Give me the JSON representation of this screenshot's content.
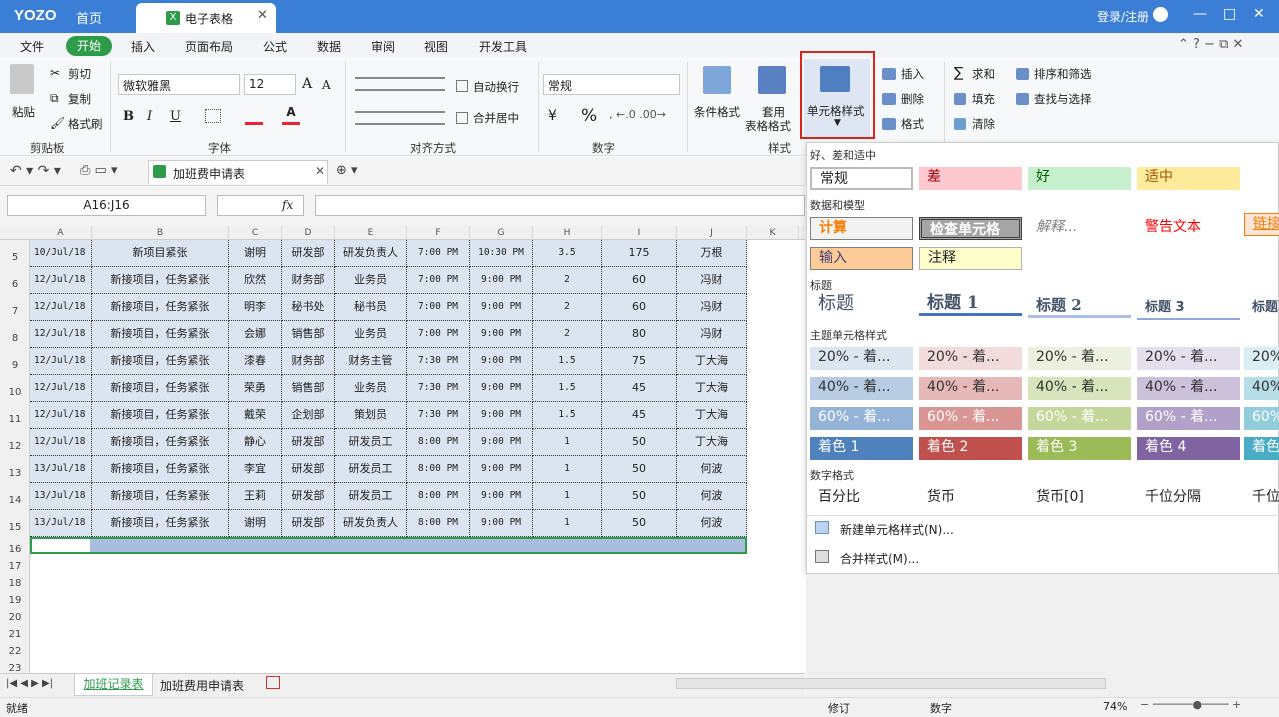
{
  "titlebar": {
    "logo": "YOZO",
    "home": "首页",
    "doc_tab": "电子表格",
    "login": "登录/注册",
    "minimize": "—",
    "restore": "□",
    "close": "✕"
  },
  "menu": {
    "items": [
      "文件",
      "开始",
      "插入",
      "页面布局",
      "公式",
      "数据",
      "审阅",
      "视图",
      "开发工具"
    ]
  },
  "ribbon": {
    "clipboard": {
      "paste": "粘贴",
      "cut": "剪切",
      "copy": "复制",
      "format_painter": "格式刷",
      "group": "剪贴板"
    },
    "font": {
      "name": "微软雅黑",
      "size": "12",
      "group": "字体",
      "bold": "B",
      "italic": "I",
      "underline": "U",
      "grow": "A",
      "shrink": "A"
    },
    "align": {
      "wrap": "自动换行",
      "merge": "合并居中",
      "group": "对齐方式"
    },
    "number": {
      "format": "常规",
      "group": "数字",
      "percent": "%",
      "currency": "¥"
    },
    "styles": {
      "cond": "条件格式",
      "table1": "套用",
      "table2": "表格格式",
      "cell": "单元格样式",
      "group": "样式"
    },
    "cells": {
      "insert": "插入",
      "delete": "删除",
      "format": "格式"
    },
    "edit": {
      "sum": "求和",
      "fill": "填充",
      "clear": "清除",
      "sort": "排序和筛选",
      "find": "查找与选择"
    }
  },
  "quick": {
    "sheet_tab": "加班费申请表"
  },
  "formula": {
    "name_box": "A16:J16",
    "fx": "fx"
  },
  "columns": [
    "A",
    "B",
    "C",
    "D",
    "E",
    "F",
    "G",
    "H",
    "I",
    "J",
    "K"
  ],
  "rows": [
    "5",
    "6",
    "7",
    "8",
    "9",
    "10",
    "11",
    "12",
    "13",
    "14",
    "15",
    "16",
    "17",
    "18",
    "19",
    "20",
    "21",
    "22",
    "23"
  ],
  "table": [
    [
      "10/Jul/18",
      "新项目紧张",
      "谢明",
      "研发部",
      "研发负责人",
      "7:00 PM",
      "10:30 PM",
      "3.5",
      "175",
      "万根"
    ],
    [
      "12/Jul/18",
      "新接项目，任务紧张",
      "欣然",
      "财务部",
      "业务员",
      "7:00 PM",
      "9:00 PM",
      "2",
      "60",
      "冯财"
    ],
    [
      "12/Jul/18",
      "新接项目，任务紧张",
      "明李",
      "秘书处",
      "秘书员",
      "7:00 PM",
      "9:00 PM",
      "2",
      "60",
      "冯财"
    ],
    [
      "12/Jul/18",
      "新接项目，任务紧张",
      "会娜",
      "销售部",
      "业务员",
      "7:00 PM",
      "9:00 PM",
      "2",
      "80",
      "冯财"
    ],
    [
      "12/Jul/18",
      "新接项目，任务紧张",
      "漆春",
      "财务部",
      "财务主管",
      "7:30 PM",
      "9:00 PM",
      "1.5",
      "75",
      "丁大海"
    ],
    [
      "12/Jul/18",
      "新接项目，任务紧张",
      "荣勇",
      "销售部",
      "业务员",
      "7:30 PM",
      "9:00 PM",
      "1.5",
      "45",
      "丁大海"
    ],
    [
      "12/Jul/18",
      "新接项目，任务紧张",
      "戴荣",
      "企划部",
      "策划员",
      "7:30 PM",
      "9:00 PM",
      "1.5",
      "45",
      "丁大海"
    ],
    [
      "12/Jul/18",
      "新接项目，任务紧张",
      "静心",
      "研发部",
      "研发员工",
      "8:00 PM",
      "9:00 PM",
      "1",
      "50",
      "丁大海"
    ],
    [
      "13/Jul/18",
      "新接项目，任务紧张",
      "李宜",
      "研发部",
      "研发员工",
      "8:00 PM",
      "9:00 PM",
      "1",
      "50",
      "何波"
    ],
    [
      "13/Jul/18",
      "新接项目，任务紧张",
      "王莉",
      "研发部",
      "研发员工",
      "8:00 PM",
      "9:00 PM",
      "1",
      "50",
      "何波"
    ],
    [
      "13/Jul/18",
      "新接项目，任务紧张",
      "谢明",
      "研发部",
      "研发负责人",
      "8:00 PM",
      "9:00 PM",
      "1",
      "50",
      "何波"
    ]
  ],
  "dropdown": {
    "sec1": "好、差和适中",
    "normal": "常规",
    "bad": "差",
    "good": "好",
    "neutral": "适中",
    "sec2": "数据和模型",
    "calc": "计算",
    "check": "检查单元格",
    "explain": "解释...",
    "warn": "警告文本",
    "link": "链接",
    "input": "输入",
    "note": "注释",
    "sec3": "标题",
    "t0": "标题",
    "t1": "标题 1",
    "t2": "标题 2",
    "t3": "标题 3",
    "t4": "标题",
    "sec4": "主题单元格样式",
    "r20": [
      "20% - 着...",
      "20% - 着...",
      "20% - 着...",
      "20% - 着...",
      "20%"
    ],
    "r40": [
      "40% - 着...",
      "40% - 着...",
      "40% - 着...",
      "40% - 着...",
      "40%"
    ],
    "r60": [
      "60% - 着...",
      "60% - 着...",
      "60% - 着...",
      "60% - 着...",
      "60%"
    ],
    "acc": [
      "着色 1",
      "着色 2",
      "着色 3",
      "着色 4",
      "着色"
    ],
    "sec5": "数字格式",
    "pct": "百分比",
    "cur": "货币",
    "cur0": "货币[0]",
    "thou": "千位分隔",
    "thou2": "千位",
    "new": "新建单元格样式(N)...",
    "merge": "合并样式(M)..."
  },
  "sheets": {
    "tab1": "加班记录表",
    "tab2": "加班费用申请表"
  },
  "status": {
    "ready": "就绪",
    "revise": "修订",
    "num": "数字",
    "zoom": "74%"
  },
  "colors": {
    "accent": "#3b7ed6",
    "green": "#2e9b4b",
    "highlight": "#d9261c"
  }
}
